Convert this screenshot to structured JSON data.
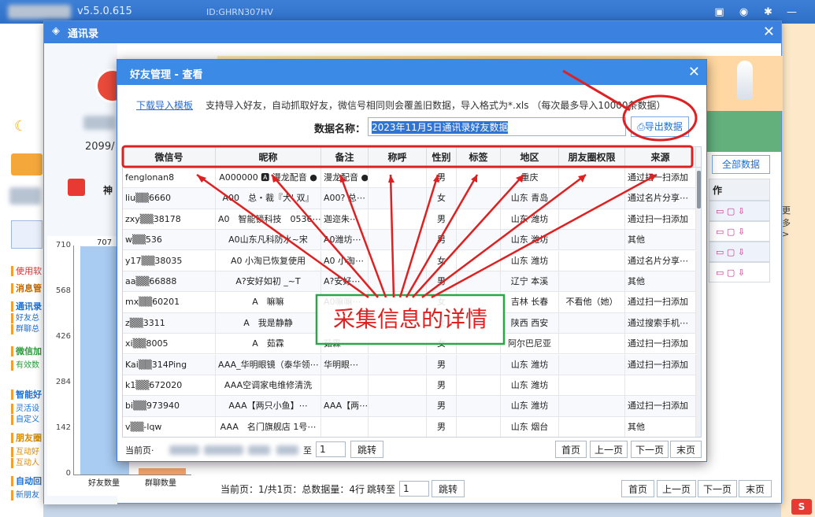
{
  "app": {
    "version": "v5.5.0.615",
    "id_label": "ID:GHRN307HV"
  },
  "contacts_window": {
    "title": "通讯录",
    "close": "✕",
    "date_value": "2099/",
    "sidebar": [
      "使用软",
      "消息管",
      "通讯录",
      "好友总",
      "群聊总",
      "微信加",
      "有效数",
      "智能好",
      "灵活设",
      "自定义",
      "朋友圈",
      "互动好",
      "互动人",
      "自动回",
      "新朋友"
    ],
    "shen_label": "神",
    "all_data_button": "全部数据",
    "op_header": "作",
    "more_label": "更多>"
  },
  "bar_chart": {
    "yticks": [
      "710",
      "568",
      "426",
      "284",
      "142",
      "0"
    ],
    "categories": [
      "好友数量",
      "群聊数量"
    ],
    "bar_value_label": "707"
  },
  "chart_data": {
    "type": "bar",
    "categories": [
      "好友数量",
      "群聊数量"
    ],
    "values": [
      707,
      20
    ],
    "yticks": [
      0,
      142,
      284,
      426,
      568,
      710
    ],
    "ylim": [
      0,
      710
    ],
    "title": "",
    "xlabel": "",
    "ylabel": ""
  },
  "bottom_pager": {
    "info": "当前页：1/共1页：总数据量：4行",
    "jump_label": "跳转至",
    "page_value": "1",
    "jump_btn": "跳转",
    "first": "首页",
    "prev": "上一页",
    "next": "下一页",
    "last": "末页"
  },
  "dialog": {
    "title": "好友管理 - 查看",
    "close": "✕",
    "download_link": "下载导入模板",
    "hint_text": "支持导入好友，自动抓取好友，微信号相同则会覆盖旧数据，导入格式为*.xls （每次最多导入10000条数据）",
    "data_name_label": "数据名称：",
    "data_name_value": "2023年11月5日通讯录好友数据",
    "export_button": "导出数据",
    "columns": [
      "微信号",
      "昵称",
      "备注",
      "称呼",
      "性别",
      "标签",
      "地区",
      "朋友圈权限",
      "来源"
    ],
    "rows": [
      {
        "wxid": "fenglonan8",
        "nick": "A000000 🅰 漫龙配音 ●",
        "remark": "漫龙配音 ●",
        "gender": "男",
        "region": "重庆",
        "perm": "",
        "source": "通过扫一扫添加"
      },
      {
        "wxid": "liu▒▒6660",
        "nick": "A00　总・裁『大' 双』",
        "remark": "A00? 总⋯",
        "gender": "女",
        "region": "山东 青岛",
        "perm": "",
        "source": "通过名片分享⋯"
      },
      {
        "wxid": "zxy▒▒38178",
        "nick": "A0　智能锁科技　0536⋯",
        "remark": "迦迩朱⋯",
        "gender": "男",
        "region": "山东 潍坊",
        "perm": "",
        "source": "通过扫一扫添加"
      },
      {
        "wxid": "w▒▒536",
        "nick": "A0山东凡科防水~宋",
        "remark": "A0潍坊⋯",
        "gender": "男",
        "region": "山东 潍坊",
        "perm": "",
        "source": "其他"
      },
      {
        "wxid": "y17▒▒38035",
        "nick": "A0 小淘已恢复使用",
        "remark": "A0 小淘⋯",
        "gender": "女",
        "region": "山东 潍坊",
        "perm": "",
        "source": "通过名片分享⋯"
      },
      {
        "wxid": "aa▒▒66888",
        "nick": "A?安好如初 _~T",
        "remark": "A?安好⋯",
        "gender": "男",
        "region": "辽宁 本溪",
        "perm": "",
        "source": "其他"
      },
      {
        "wxid": "mx▒▒60201",
        "nick": "A　嘛嘛",
        "remark": "A0嘛嘛⋯",
        "gender": "女",
        "region": "吉林 长春",
        "perm": "不看他（她）",
        "source": "通过扫一扫添加"
      },
      {
        "wxid": "z▒▒3311",
        "nick": "A　我是静静",
        "remark": "",
        "gender": "女",
        "region": "陕西 西安",
        "perm": "",
        "source": "通过搜索手机⋯"
      },
      {
        "wxid": "xi▒▒8005",
        "nick": "A　茹霖",
        "remark": "茹霖",
        "gender": "女",
        "region": "阿尔巴尼亚",
        "perm": "",
        "source": "通过扫一扫添加"
      },
      {
        "wxid": "Kai▒▒314Ping",
        "nick": "AAA_华明眼镜（泰华领⋯",
        "remark": "华明眼⋯",
        "gender": "男",
        "region": "山东 潍坊",
        "perm": "",
        "source": "通过扫一扫添加"
      },
      {
        "wxid": "k1▒▒672020",
        "nick": "AAA空调家电维修清洗",
        "remark": "",
        "gender": "男",
        "region": "山东 潍坊",
        "perm": "",
        "source": ""
      },
      {
        "wxid": "bi▒▒973940",
        "nick": "AAA【两只小鱼】⋯",
        "remark": "AAA【两⋯",
        "gender": "男",
        "region": "山东 潍坊",
        "perm": "",
        "source": "通过扫一扫添加"
      },
      {
        "wxid": "v▒▒-lqw",
        "nick": "AAA　名门旗舰店 1号⋯",
        "remark": "",
        "gender": "男",
        "region": "山东 烟台",
        "perm": "",
        "source": "其他"
      }
    ],
    "pager": {
      "current_label": "当前页·",
      "jump_label": "至",
      "page_value": "1",
      "jump_btn": "跳转",
      "first": "首页",
      "prev": "上一页",
      "next": "下一页",
      "last": "末页"
    }
  },
  "annotation": {
    "text": "采集信息的详情",
    "color": "#e02020",
    "box_color": "#28a745"
  }
}
